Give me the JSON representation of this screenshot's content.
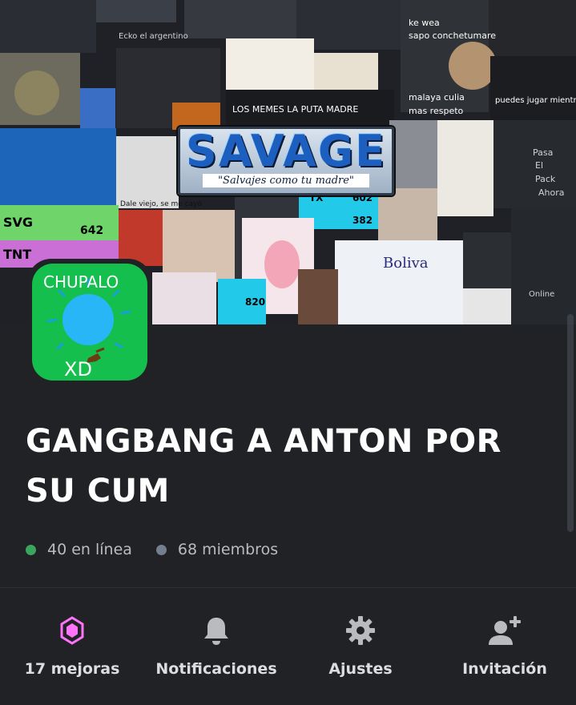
{
  "banner": {
    "logo_main": "SAVAGE",
    "logo_tagline": "\"Salvajes como tu madre\"",
    "collage_texts": [
      "Ecko el argentino",
      "ke wea",
      "sapo conchetumare",
      "malaya culia",
      "mas respeto",
      "LOS MEMES LA PUTA MADRE",
      "Dale viejo, se me cayó",
      "puedes jugar mientras juega",
      "Pasa",
      "El",
      "Pack",
      "Ahora",
      "TX",
      "SVG",
      "TNT",
      "642",
      "602",
      "382",
      "820",
      "Boliva",
      "Online"
    ]
  },
  "server": {
    "icon_text_top": "CHUPALO",
    "icon_text_bottom": "XD",
    "name": "GANGBANG A ANTON POR SU CUM",
    "online_text": "40 en línea",
    "members_text": "68 miembros",
    "online_color": "#3ba55d",
    "members_color": "#747f8d"
  },
  "actions": [
    {
      "label": "17 mejoras",
      "icon": "boost-gem-icon",
      "color": "#ff73fa"
    },
    {
      "label": "Notificaciones",
      "icon": "bell-icon",
      "color": "#b9bbbe"
    },
    {
      "label": "Ajustes",
      "icon": "gear-icon",
      "color": "#b9bbbe"
    },
    {
      "label": "Invitación",
      "icon": "add-user-icon",
      "color": "#b9bbbe"
    }
  ]
}
